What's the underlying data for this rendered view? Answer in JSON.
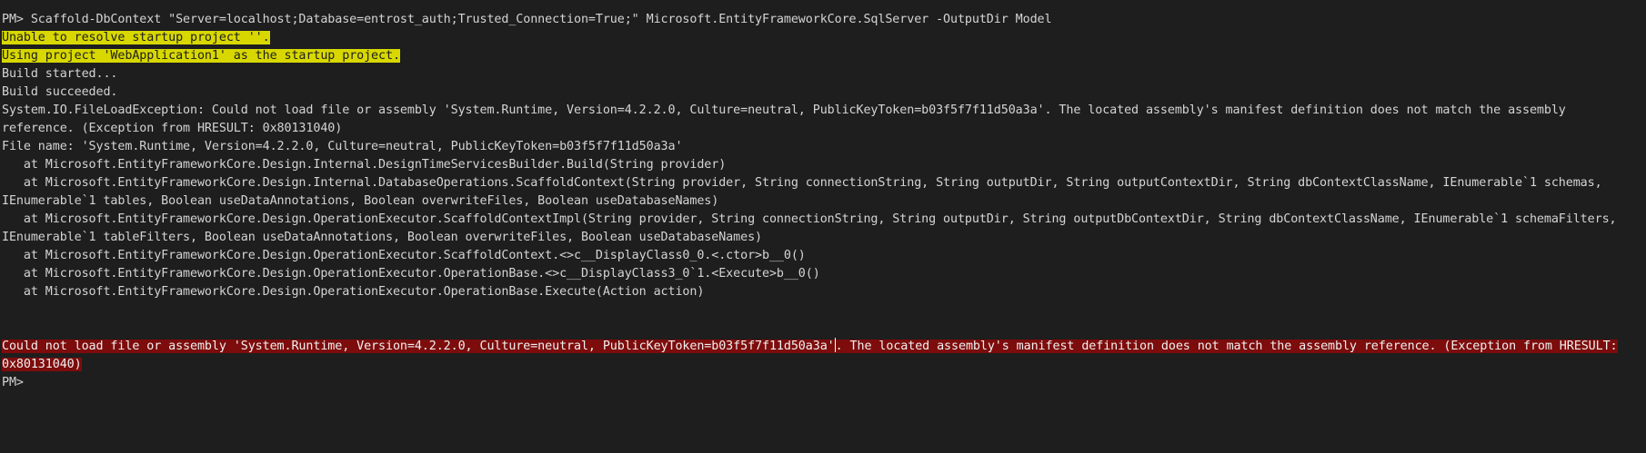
{
  "console": {
    "lines": [
      "PM> Scaffold-DbContext \"Server=localhost;Database=entrost_auth;Trusted_Connection=True;\" Microsoft.EntityFrameworkCore.SqlServer -OutputDir Model",
      "Unable to resolve startup project ''.",
      "Using project 'WebApplication1' as the startup project.",
      "Build started...",
      "Build succeeded.",
      "System.IO.FileLoadException: Could not load file or assembly 'System.Runtime, Version=4.2.2.0, Culture=neutral, PublicKeyToken=b03f5f7f11d50a3a'. The located assembly's manifest definition does not match the assembly",
      "reference. (Exception from HRESULT: 0x80131040)",
      "File name: 'System.Runtime, Version=4.2.2.0, Culture=neutral, PublicKeyToken=b03f5f7f11d50a3a'",
      "   at Microsoft.EntityFrameworkCore.Design.Internal.DesignTimeServicesBuilder.Build(String provider)",
      "   at Microsoft.EntityFrameworkCore.Design.Internal.DatabaseOperations.ScaffoldContext(String provider, String connectionString, String outputDir, String outputContextDir, String dbContextClassName, IEnumerable`1 schemas,",
      "IEnumerable`1 tables, Boolean useDataAnnotations, Boolean overwriteFiles, Boolean useDatabaseNames)",
      "   at Microsoft.EntityFrameworkCore.Design.OperationExecutor.ScaffoldContextImpl(String provider, String connectionString, String outputDir, String outputDbContextDir, String dbContextClassName, IEnumerable`1 schemaFilters,",
      "IEnumerable`1 tableFilters, Boolean useDataAnnotations, Boolean overwriteFiles, Boolean useDatabaseNames)",
      "   at Microsoft.EntityFrameworkCore.Design.OperationExecutor.ScaffoldContext.<>c__DisplayClass0_0.<.ctor>b__0()",
      "   at Microsoft.EntityFrameworkCore.Design.OperationExecutor.OperationBase.<>c__DisplayClass3_0`1.<Execute>b__0()",
      "   at Microsoft.EntityFrameworkCore.Design.OperationExecutor.OperationBase.Execute(Action action)"
    ],
    "error_line1_before_cursor": "Could not load file or assembly 'System.Runtime, Version=4.2.2.0, Culture=neutral, PublicKeyToken=b03f5f7f11d50a3a'",
    "error_line1_after_cursor": ". The located assembly's manifest definition does not match the assembly reference. (Exception from HRESULT:",
    "error_line2": "0x80131040)",
    "prompt": "PM>"
  },
  "colors": {
    "background": "#1e1e1e",
    "text": "#d4d4d4",
    "warning_highlight": "#d8d800",
    "error_background": "#7d0c0c"
  }
}
